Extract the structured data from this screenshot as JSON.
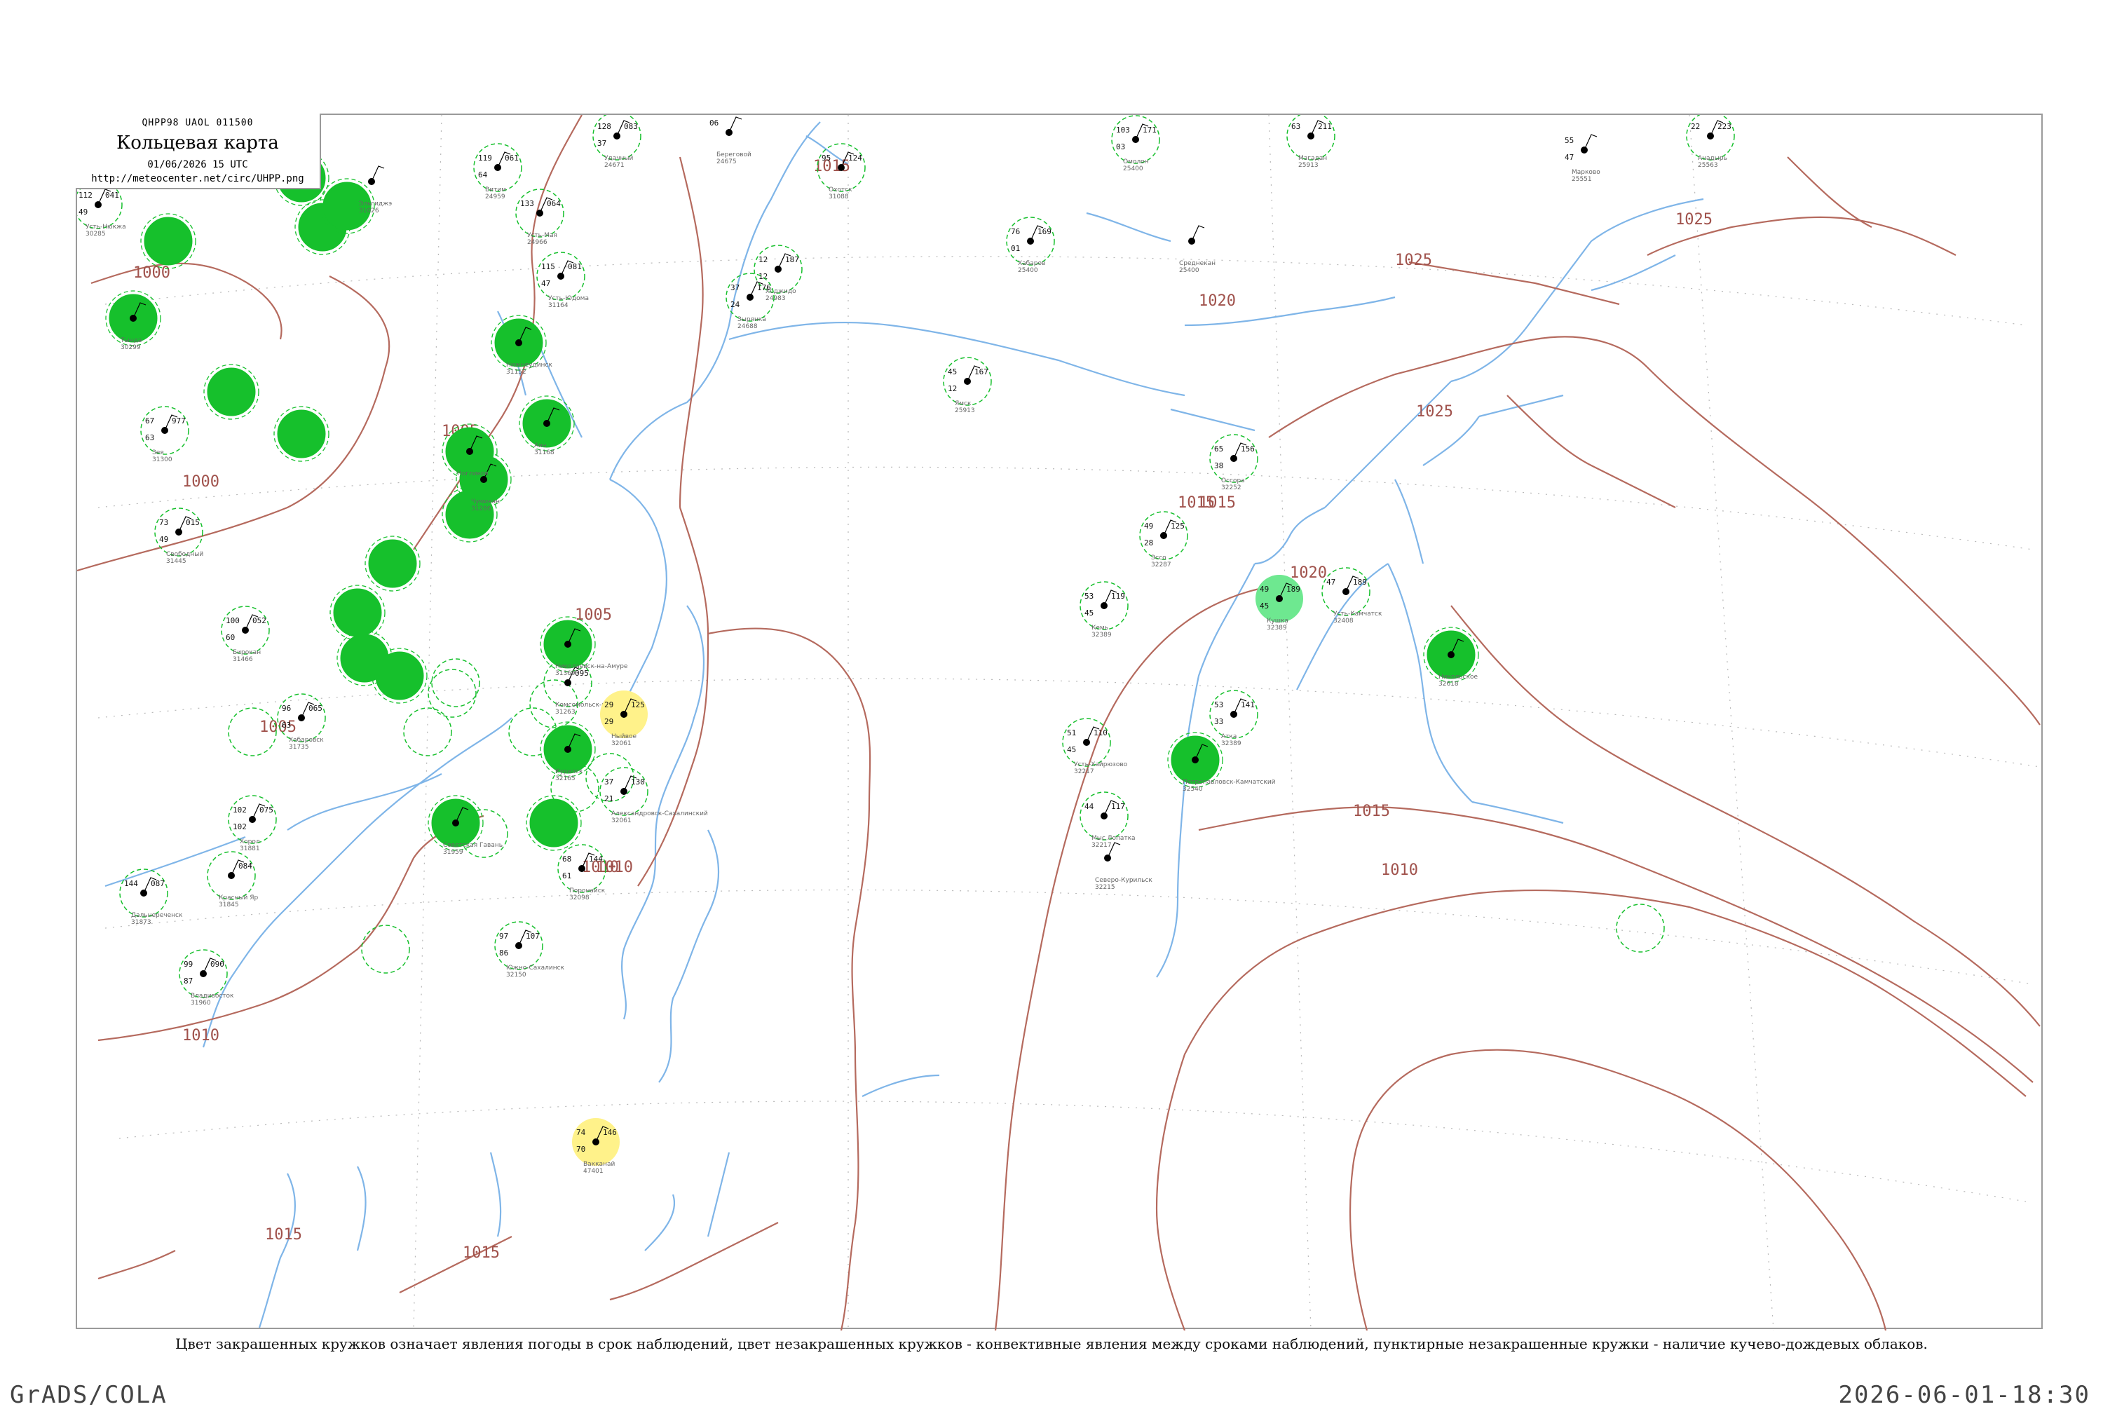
{
  "header": {
    "codes": "QHPP98  UAOL  011500",
    "title": "Кольцевая карта",
    "time": "01/06/2026 15 UTC",
    "url": "http://meteocenter.net/circ/UHPP.png"
  },
  "caption": "Цвет закрашенных кружков означает явления погоды в срок наблюдений, цвет незакрашенных кружков - конвективные явления между сроками наблюдений, пунктирные незакрашенные кружки - наличие кучево-дождевых облаков.",
  "footer": {
    "left": "GrADS/COLA",
    "right": "2026-06-01-18:30"
  },
  "colors": {
    "coast": "#7fb5e8",
    "isobar": "#b56a5e",
    "shower": "#16c02c",
    "thunder": "#fff28a",
    "light": "#6ee890",
    "grid": "#b0b0b0"
  },
  "isobar_labels": [
    "1000",
    "1000",
    "1005",
    "1005",
    "1005",
    "1010",
    "1010",
    "1010",
    "1015",
    "1015",
    "1015",
    "1015",
    "1015",
    "1020",
    "1020",
    "1025",
    "1025",
    "1025",
    "1010",
    "1015"
  ],
  "stations": [
    {
      "name": "Усть-Нюкжа",
      "id": "30285",
      "p": "041",
      "t": "112",
      "td": "49",
      "fill": "none"
    },
    {
      "name": "Тында",
      "id": "30299",
      "p": "",
      "t": "",
      "td": "",
      "fill": "shower"
    },
    {
      "name": "Зея",
      "id": "31300",
      "p": "977",
      "t": "67",
      "td": "63",
      "fill": "none"
    },
    {
      "name": "Свободный",
      "id": "31445",
      "p": "015",
      "t": "73",
      "td": "49",
      "fill": "none"
    },
    {
      "name": "Бирокан",
      "id": "31466",
      "p": "052",
      "t": "100",
      "td": "60",
      "fill": "none"
    },
    {
      "name": "Хабаровск",
      "id": "31735",
      "p": "065",
      "t": "96",
      "td": "63",
      "fill": "none"
    },
    {
      "name": "Хорол",
      "id": "31881",
      "p": "075",
      "t": "102",
      "td": "102",
      "fill": "none"
    },
    {
      "name": "Дальнереченск",
      "id": "31873",
      "p": "087",
      "t": "144",
      "td": "",
      "fill": "none"
    },
    {
      "name": "Красный Яр",
      "id": "31845",
      "p": "084",
      "t": "",
      "td": "",
      "fill": "none"
    },
    {
      "name": "Комсомольск-на-Амуре",
      "id": "31263",
      "p": "095",
      "t": "",
      "td": "",
      "fill": "none"
    },
    {
      "name": "Николаевск-на-Амуре",
      "id": "31369",
      "p": "",
      "t": "",
      "td": "",
      "fill": "shower"
    },
    {
      "name": "Ныйвое",
      "id": "32061",
      "p": "125",
      "t": "29",
      "td": "29",
      "fill": "thunder"
    },
    {
      "name": "Александровск-Сахалинский",
      "id": "32061",
      "p": "130",
      "t": "37",
      "td": "21",
      "fill": "none"
    },
    {
      "name": "Поронайск",
      "id": "32098",
      "p": "144",
      "t": "68",
      "td": "61",
      "fill": "none"
    },
    {
      "name": "Южно-Сахалинск",
      "id": "32150",
      "p": "107",
      "t": "97",
      "td": "86",
      "fill": "none"
    },
    {
      "name": "Советская Гавань",
      "id": "31959",
      "p": "",
      "t": "",
      "td": "",
      "fill": "shower"
    },
    {
      "name": "Владивосток",
      "id": "31960",
      "p": "090",
      "t": "99",
      "td": "87",
      "fill": "none"
    },
    {
      "name": "Охотск",
      "id": "31088",
      "p": "124",
      "t": "95",
      "td": "",
      "fill": "none"
    },
    {
      "name": "Магадан",
      "id": "25913",
      "p": "211",
      "t": "63",
      "td": "",
      "fill": "none"
    },
    {
      "name": "Северо-Курильск",
      "id": "32215",
      "p": "",
      "t": "",
      "td": "",
      "fill": "none"
    },
    {
      "name": "Петропавловск-Камчатский",
      "id": "32540",
      "p": "",
      "t": "",
      "td": "",
      "fill": "shower"
    },
    {
      "name": "Усть-Камчатск",
      "id": "32408",
      "p": "189",
      "t": "47",
      "td": "",
      "fill": "none"
    },
    {
      "name": "Никольское",
      "id": "32618",
      "p": "",
      "t": "",
      "td": "",
      "fill": "shower"
    },
    {
      "name": "Кушка",
      "id": "32389",
      "p": "189",
      "t": "49",
      "td": "45",
      "fill": "light"
    },
    {
      "name": "Мыс Лопатка",
      "id": "32217",
      "p": "117",
      "t": "44",
      "td": "",
      "fill": "none"
    },
    {
      "name": "Вакканай",
      "id": "47401",
      "p": "146",
      "t": "74",
      "td": "70",
      "fill": "thunder"
    },
    {
      "name": "Курилск",
      "id": "32165",
      "p": "",
      "t": "",
      "td": "",
      "fill": "shower"
    },
    {
      "name": "Кемь",
      "id": "32389",
      "p": "119",
      "t": "53",
      "td": "45",
      "fill": "none"
    },
    {
      "name": "Эссо",
      "id": "32287",
      "p": "125",
      "t": "49",
      "td": "28",
      "fill": "none"
    },
    {
      "name": "Анадырь",
      "id": "25563",
      "p": "223",
      "t": "22",
      "td": "",
      "fill": "none"
    },
    {
      "name": "Марково",
      "id": "25551",
      "p": "",
      "t": "55",
      "td": "47",
      "fill": "none"
    },
    {
      "name": "Оссора",
      "id": "32252",
      "p": "156",
      "t": "65",
      "td": "38",
      "fill": "none"
    },
    {
      "name": "Усть-Хайрюзово",
      "id": "32217",
      "p": "110",
      "t": "51",
      "td": "45",
      "fill": "none"
    },
    {
      "name": "Атка",
      "id": "32389",
      "p": "141",
      "t": "53",
      "td": "33",
      "fill": "none"
    },
    {
      "name": "Аян",
      "id": "31168",
      "p": "",
      "t": "",
      "td": "",
      "fill": "shower"
    },
    {
      "name": "Чумикан",
      "id": "31286",
      "p": "",
      "t": "",
      "td": "",
      "fill": "shower"
    },
    {
      "name": "Нижнеудинск",
      "id": "31152",
      "p": "",
      "t": "",
      "td": "",
      "fill": "shower"
    },
    {
      "name": "Ногликов",
      "id": "",
      "p": "",
      "t": "",
      "td": "",
      "fill": "shower"
    },
    {
      "name": "Усть-Юдома",
      "id": "31164",
      "p": "081",
      "t": "115",
      "td": "47",
      "fill": "none"
    },
    {
      "name": "Усть-Мая",
      "id": "24966",
      "p": "064",
      "t": "133",
      "td": "",
      "fill": "none"
    },
    {
      "name": "Эльгиджэ",
      "id": "31026",
      "p": "",
      "t": "",
      "td": "",
      "fill": "none"
    },
    {
      "name": "Хабаров",
      "id": "25400",
      "p": "169",
      "t": "76",
      "td": "01",
      "fill": "none"
    },
    {
      "name": "Омолон",
      "id": "25400",
      "p": "171",
      "t": "103",
      "td": "03",
      "fill": "none"
    },
    {
      "name": "Ходжидо",
      "id": "24983",
      "p": "187",
      "t": "12",
      "td": "12",
      "fill": "none"
    },
    {
      "name": "Зырянка",
      "id": "24688",
      "p": "176",
      "t": "37",
      "td": "24",
      "fill": "none"
    },
    {
      "name": "Ямск",
      "id": "25913",
      "p": "167",
      "t": "45",
      "td": "12",
      "fill": "none"
    },
    {
      "name": "Среднекан",
      "id": "25400",
      "p": "",
      "t": "",
      "td": "",
      "fill": "none"
    },
    {
      "name": "Витим",
      "id": "24959",
      "p": "061",
      "t": "119",
      "td": "64",
      "fill": "none"
    },
    {
      "name": "Удачный",
      "id": "24671",
      "p": "083",
      "t": "128",
      "td": "37",
      "fill": "none"
    },
    {
      "name": "Береговой",
      "id": "24675",
      "p": "",
      "t": "06",
      "td": "",
      "fill": "none"
    }
  ]
}
